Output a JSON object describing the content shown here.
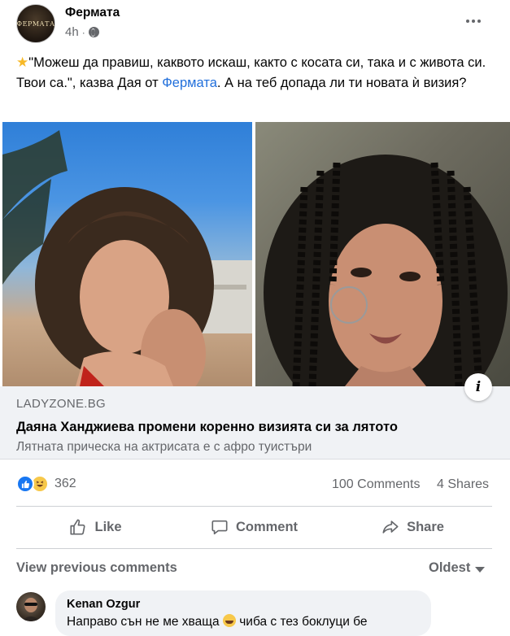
{
  "post": {
    "page_name": "Фермата",
    "time": "4h",
    "separator": "·",
    "avatar_text": "ФЕРМАТА",
    "text_before_link": "\"Можеш да правиш, каквото искаш, както с косата си, така и с живота си. Твои са.\", казва Дая от ",
    "text_link": "Фермата",
    "text_after_link": ". А на теб допада ли ти новата ѝ визия?"
  },
  "link_preview": {
    "domain": "LADYZONE.BG",
    "title": "Даяна Ханджиева промени коренно визията си за лятото",
    "description": "Лятната прическа на актрисата е с афро туистъри",
    "info_label": "i"
  },
  "stats": {
    "reactions_count": "362",
    "comments": "100 Comments",
    "shares": "4 Shares"
  },
  "actions": {
    "like": "Like",
    "comment": "Comment",
    "share": "Share"
  },
  "comments_section": {
    "view_previous": "View previous comments",
    "sort": "Oldest"
  },
  "comment": {
    "author": "Kenan Ozgur",
    "text_before_emoji": "Направо сън не ме хваща ",
    "text_after_emoji": " чиба с тез боклуци бе"
  },
  "icons": {
    "star": "star-icon",
    "globe": "globe-icon",
    "more": "more-icon",
    "like": "thumbs-up-icon",
    "comment": "comment-icon",
    "share": "share-icon"
  },
  "colors": {
    "link": "#216fdb",
    "secondary_text": "#65676b",
    "like_blue": "#1877f2",
    "haha_yellow": "#f7c84a"
  }
}
